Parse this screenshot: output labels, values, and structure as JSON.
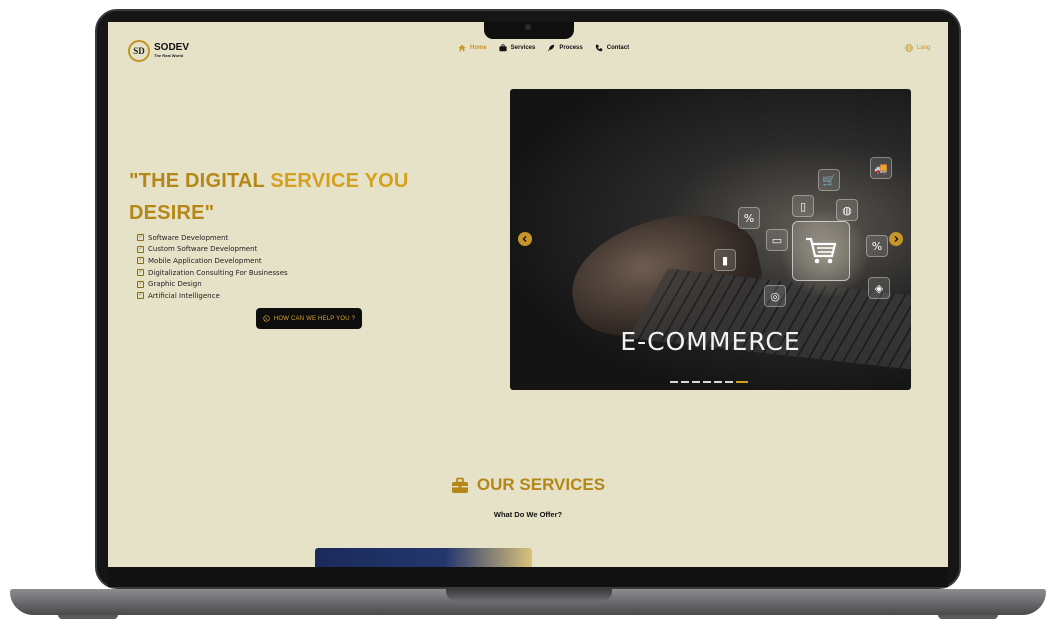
{
  "logo": {
    "mark": "SD",
    "name": "SODEV",
    "tagline": "The Real World"
  },
  "nav": [
    {
      "label": "Home",
      "icon": "home-icon",
      "active": true
    },
    {
      "label": "Services",
      "icon": "briefcase-icon",
      "active": false
    },
    {
      "label": "Process",
      "icon": "rocket-icon",
      "active": false
    },
    {
      "label": "Contact",
      "icon": "phone-icon",
      "active": false
    }
  ],
  "lang_label": "Lang",
  "hero": {
    "title_part1": "\"THE DIGITAL ",
    "title_part2": "SERVICE YOU",
    "title_part3": "DESIRE\"",
    "features": [
      "Software Development",
      "Custom Software Development",
      "Mobile Application Development",
      "Digitalization Consulting For Businesses",
      "Graphic Design",
      "Artificial Intelligence"
    ],
    "cta_label": "HOW CAN WE HELP YOU ?"
  },
  "carousel": {
    "caption": "E-COMMERCE",
    "slide_count": 7,
    "active_index": 6
  },
  "services": {
    "title": "OUR SERVICES",
    "subtitle": "What Do We Offer?"
  },
  "colors": {
    "background": "#e5e2c8",
    "gold": "#c6962a",
    "dark": "#0d0d0d"
  }
}
